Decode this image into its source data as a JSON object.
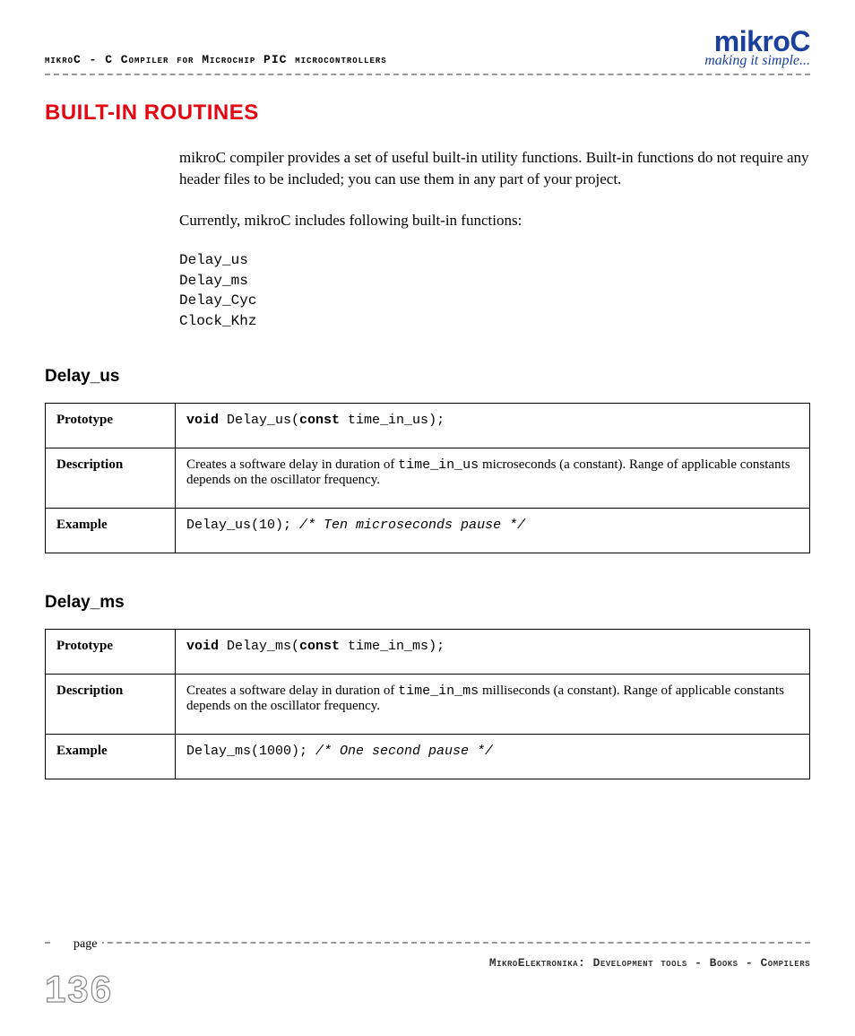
{
  "header": {
    "left": "mikroC - C Compiler for Microchip PIC microcontrollers",
    "brand": "mikroC",
    "tagline": "making it simple..."
  },
  "title": "BUILT-IN ROUTINES",
  "intro": {
    "p1": "mikroC compiler provides a set of useful built-in utility functions. Built-in functions do not require any header files to be included; you can use them in any part of your project.",
    "p2": "Currently, mikroC includes following built-in functions:"
  },
  "func_list": "Delay_us\nDelay_ms\nDelay_Cyc\nClock_Khz",
  "row_labels": {
    "prototype": "Prototype",
    "description": "Description",
    "example": "Example"
  },
  "delay_us": {
    "heading": "Delay_us",
    "proto_pre": "void",
    "proto_mid_a": " Delay_us(",
    "proto_kw": "const",
    "proto_mid_b": " time_in_us);",
    "desc_a": "Creates a software delay in duration of ",
    "desc_code": "time_in_us",
    "desc_b": " microseconds (a constant). Range of applicable constants depends on the oscillator frequency.",
    "example_code": "Delay_us(10);  ",
    "example_comment": "/* Ten microseconds pause */"
  },
  "delay_ms": {
    "heading": "Delay_ms",
    "proto_pre": "void",
    "proto_mid_a": " Delay_ms(",
    "proto_kw": "const",
    "proto_mid_b": " time_in_ms);",
    "desc_a": "Creates a software delay in duration of ",
    "desc_code": "time_in_ms",
    "desc_b": " milliseconds (a constant). Range of applicable constants depends on the oscillator frequency.",
    "example_code": "Delay_ms(1000);  ",
    "example_comment": "/* One second pause */"
  },
  "footer": {
    "page_label": "page",
    "page_number": "136",
    "text": "MikroElektronika: Development tools - Books - Compilers"
  }
}
